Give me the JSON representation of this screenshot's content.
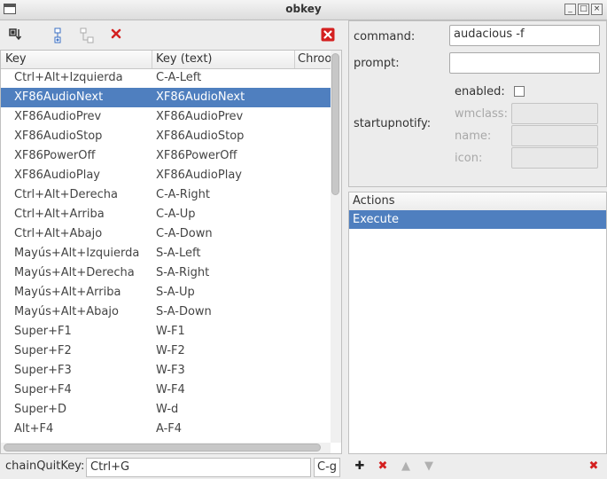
{
  "window": {
    "title": "obkey"
  },
  "colors": {
    "selection": "#4f7fbf",
    "delete_red": "#d42020",
    "add_blue": "#3a6fc4"
  },
  "toolbar": {
    "icons": [
      "toggle-view-icon",
      "add-sibling-icon",
      "add-child-icon",
      "delete-icon",
      "close-red-icon"
    ]
  },
  "list": {
    "columns": [
      "Key",
      "Key (text)",
      "Chroo"
    ],
    "rows": [
      {
        "key": "Ctrl+Alt+Izquierda",
        "text": "C-A-Left"
      },
      {
        "key": "XF86AudioNext",
        "text": "XF86AudioNext",
        "selected": true
      },
      {
        "key": "XF86AudioPrev",
        "text": "XF86AudioPrev"
      },
      {
        "key": "XF86AudioStop",
        "text": "XF86AudioStop"
      },
      {
        "key": "XF86PowerOff",
        "text": "XF86PowerOff"
      },
      {
        "key": "XF86AudioPlay",
        "text": "XF86AudioPlay"
      },
      {
        "key": "Ctrl+Alt+Derecha",
        "text": "C-A-Right"
      },
      {
        "key": "Ctrl+Alt+Arriba",
        "text": "C-A-Up"
      },
      {
        "key": "Ctrl+Alt+Abajo",
        "text": "C-A-Down"
      },
      {
        "key": "Mayús+Alt+Izquierda",
        "text": "S-A-Left"
      },
      {
        "key": "Mayús+Alt+Derecha",
        "text": "S-A-Right"
      },
      {
        "key": "Mayús+Alt+Arriba",
        "text": "S-A-Up"
      },
      {
        "key": "Mayús+Alt+Abajo",
        "text": "S-A-Down"
      },
      {
        "key": "Super+F1",
        "text": "W-F1"
      },
      {
        "key": "Super+F2",
        "text": "W-F2"
      },
      {
        "key": "Super+F3",
        "text": "W-F3"
      },
      {
        "key": "Super+F4",
        "text": "W-F4"
      },
      {
        "key": "Super+D",
        "text": "W-d"
      },
      {
        "key": "Alt+F4",
        "text": "A-F4"
      }
    ]
  },
  "chain": {
    "label": "chainQuitKey:",
    "value": "Ctrl+G",
    "text_value": "C-g"
  },
  "properties": {
    "command_label": "command:",
    "command_value": "audacious -f",
    "prompt_label": "prompt:",
    "prompt_value": "",
    "startupnotify_label": "startupnotify:",
    "enabled_label": "enabled:",
    "wmclass_label": "wmclass:",
    "name_label": "name:",
    "icon_label": "icon:"
  },
  "actions": {
    "header": "Actions",
    "items": [
      "Execute"
    ]
  }
}
